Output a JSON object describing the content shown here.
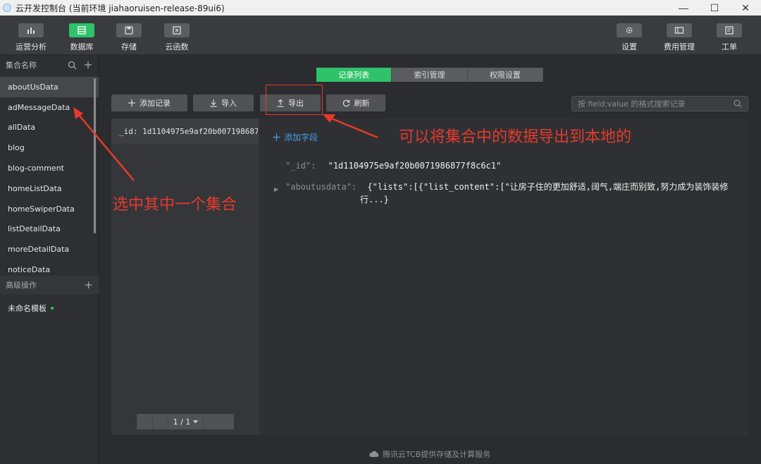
{
  "window": {
    "title": "云开发控制台 (当前环境 jiahaoruisen-release-89ui6)",
    "controls": [
      "—",
      "☐",
      "✕"
    ]
  },
  "toolbar": {
    "left": [
      {
        "label": "运营分析",
        "icon": "bar-chart-icon"
      },
      {
        "label": "数据库",
        "icon": "database-icon",
        "active": true
      },
      {
        "label": "存储",
        "icon": "storage-icon"
      },
      {
        "label": "云函数",
        "icon": "function-icon"
      }
    ],
    "right": [
      {
        "label": "设置",
        "icon": "gear-icon"
      },
      {
        "label": "费用管理",
        "icon": "billing-icon"
      },
      {
        "label": "工单",
        "icon": "ticket-icon"
      }
    ]
  },
  "sidebar": {
    "header": "集合名称",
    "collections": [
      "aboutUsData",
      "adMessageData",
      "allData",
      "blog",
      "blog-comment",
      "homeListData",
      "homeSwiperData",
      "listDetailData",
      "moreDetailData",
      "noticeData"
    ],
    "selected": "aboutUsData",
    "advanced_header": "高级操作",
    "template_item": "未命名模板"
  },
  "tabs": [
    "记录列表",
    "索引管理",
    "权限设置"
  ],
  "actions": {
    "add_record": "添加记录",
    "import": "导入",
    "export": "导出",
    "refresh": "刷新"
  },
  "search": {
    "placeholder": "按 field:value 的格式搜索记录"
  },
  "records": {
    "items": [
      "_id: 1d1104975e9af20b007198687..."
    ],
    "pager": "1 / 1"
  },
  "detail": {
    "add_field": "添加字段",
    "fields": [
      {
        "key": "\"_id\":",
        "value": "\"1d1104975e9af20b0071986877f8c6c1\""
      },
      {
        "key": "\"aboutusdata\":",
        "value": "{\"lists\":[{\"list_content\":[\"让房子住的更加舒适,阔气,端庄而别致,努力成为装饰装修",
        "value_cont": "行...}"
      }
    ]
  },
  "footer": "腾讯云TCB提供存储及计算服务",
  "annotations": {
    "export_note": "可以将集合中的数据导出到本地的",
    "select_note": "选中其中一个集合"
  },
  "colors": {
    "accent": "#2fc26a",
    "link": "#4a9de8",
    "annotation": "#e53a2d"
  }
}
